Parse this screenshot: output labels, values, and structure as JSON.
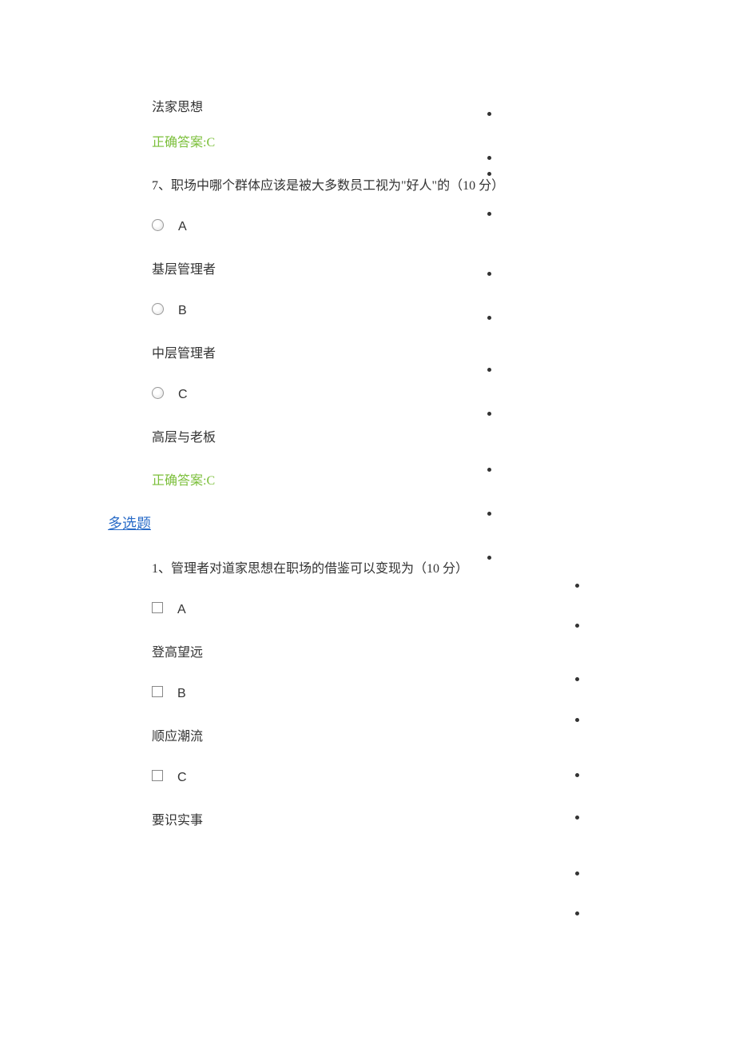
{
  "prev_q6": {
    "last_option_text": "法家思想",
    "answer": "正确答案:C"
  },
  "q7": {
    "title": "7、职场中哪个群体应该是被大多数员工视为\"好人\"的（10 分）",
    "options": [
      {
        "label": "A",
        "text": "基层管理者"
      },
      {
        "label": "B",
        "text": "中层管理者"
      },
      {
        "label": "C",
        "text": "高层与老板"
      }
    ],
    "answer": "正确答案:C"
  },
  "section2": {
    "heading": "多选题"
  },
  "mq1": {
    "title": "1、管理者对道家思想在职场的借鉴可以变现为（10 分）",
    "options": [
      {
        "label": "A",
        "text": "登高望远"
      },
      {
        "label": "B",
        "text": "顺应潮流"
      },
      {
        "label": "C",
        "text": "要识实事"
      }
    ]
  }
}
